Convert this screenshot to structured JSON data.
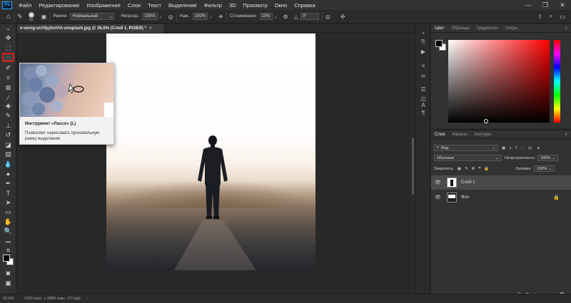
{
  "app": {
    "logo": "Ps"
  },
  "menu": [
    "Файл",
    "Редактирование",
    "Изображение",
    "Слои",
    "Текст",
    "Выделение",
    "Фильтр",
    "3D",
    "Просмотр",
    "Окно",
    "Справка"
  ],
  "window_controls": [
    "—",
    "❐",
    "✕"
  ],
  "options": {
    "brush_size": "62",
    "mode_label": "Режим:",
    "mode_value": "Нормальный",
    "opacity_label": "Непрозр.:",
    "opacity_value": "100%",
    "flow_label": "Наж.:",
    "flow_value": "100%",
    "smoothing_label": "Сглаживание:",
    "smoothing_value": "10%",
    "angle_value": "0°"
  },
  "document_tab": {
    "title": "e-wong-uuVlpykoViA-unsplash.jpg @ 36,6% (Слой 1, RGB/8) *",
    "close": "×"
  },
  "tooltip": {
    "title": "Инструмент «Лассо» (L)",
    "description": "Позволяет нарисовать произвольную рамку выделения"
  },
  "color_panel": {
    "tabs": [
      "Цвет",
      "Образцы",
      "Градиенты",
      "Узоры"
    ],
    "active_tab": "Цвет",
    "foreground": "#000000",
    "background": "#ffffff"
  },
  "layers_panel": {
    "tabs": [
      "Слои",
      "Каналы",
      "Контуры"
    ],
    "active_tab": "Слои",
    "filter_label": "Вид",
    "blend_mode": "Обычные",
    "opacity_label": "Непрозрачность:",
    "opacity_value": "100%",
    "lock_label": "Закрепить:",
    "fill_label": "Заливка:",
    "fill_value": "100%",
    "layers": [
      {
        "name": "Слой 1",
        "selected": true,
        "locked": false
      },
      {
        "name": "Фон",
        "selected": false,
        "locked": true
      }
    ],
    "footer_icons": [
      "link-icon",
      "fx-icon",
      "mask-icon",
      "adjustment-icon",
      "group-icon",
      "new-layer-icon",
      "trash-icon"
    ],
    "footer_glyphs": [
      "⚭",
      "fx",
      "◘",
      "◑",
      "▬",
      "＋",
      "🗑"
    ]
  },
  "status": {
    "zoom": "36,6%",
    "doc_info": "1920 пикс. x 2880 пикс. (72 ppi)"
  }
}
